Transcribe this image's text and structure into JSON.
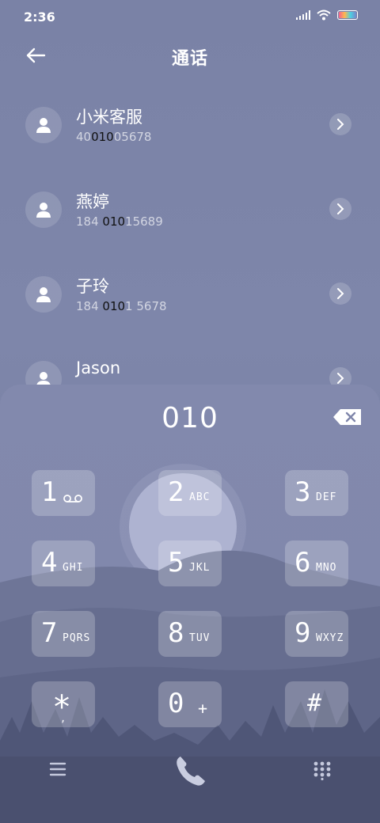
{
  "status": {
    "time": "2:36"
  },
  "header": {
    "title": "通话"
  },
  "contacts": [
    {
      "name": "小米客服",
      "num_pre": "40",
      "num_match": "010",
      "num_post": "05678"
    },
    {
      "name": "燕婷",
      "num_pre": "184 ",
      "num_match": "010",
      "num_post": "15689"
    },
    {
      "name": "子玲",
      "num_pre": "184 ",
      "num_match": "010",
      "num_post": "1 5678"
    },
    {
      "name": "Jason",
      "num_pre": "",
      "num_match": "",
      "num_post": ""
    }
  ],
  "dialpad": {
    "input": "010",
    "keys": [
      {
        "digit": "1",
        "letters": ""
      },
      {
        "digit": "2",
        "letters": "ABC"
      },
      {
        "digit": "3",
        "letters": "DEF"
      },
      {
        "digit": "4",
        "letters": "GHI"
      },
      {
        "digit": "5",
        "letters": "JKL"
      },
      {
        "digit": "6",
        "letters": "MNO"
      },
      {
        "digit": "7",
        "letters": "PQRS"
      },
      {
        "digit": "8",
        "letters": "TUV"
      },
      {
        "digit": "9",
        "letters": "WXYZ"
      },
      {
        "digit": "*",
        "letters": ","
      },
      {
        "digit": "0",
        "letters": "+"
      },
      {
        "digit": "#",
        "letters": ""
      }
    ]
  },
  "icons": {
    "back": "arrow-left-icon",
    "voicemail": "voicemail-icon",
    "backspace": "backspace-icon",
    "menu": "menu-icon",
    "call": "phone-icon",
    "dialpad": "dialpad-icon"
  }
}
